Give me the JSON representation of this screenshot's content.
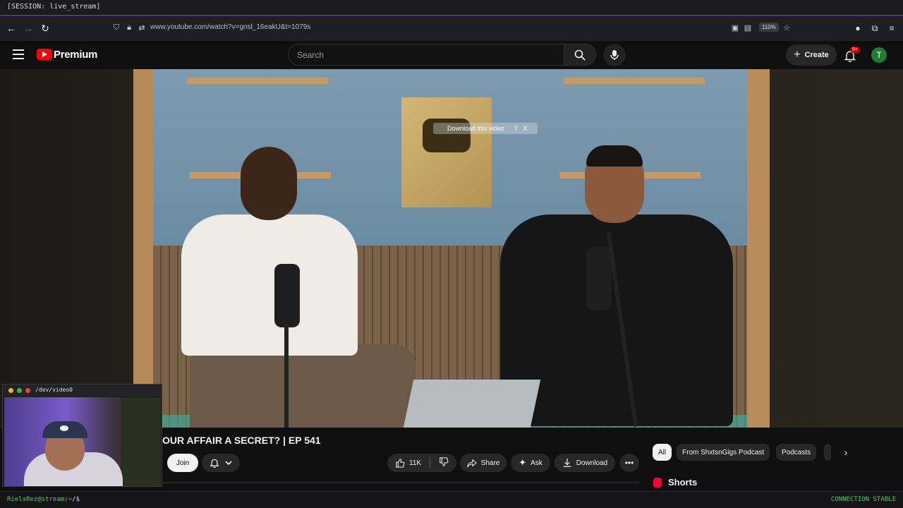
{
  "session": {
    "label": "[SESSION: live_stream]"
  },
  "browser": {
    "url": "www.youtube.com/watch?v=gnsl_16eakU&t=1079s",
    "zoom": "110%"
  },
  "youtube": {
    "brand": "Premium",
    "search_placeholder": "Search",
    "create_label": "Create",
    "notifications_badge": "9+",
    "avatar_letter": "T"
  },
  "video": {
    "overlay_text": "Download this video",
    "overlay_help": "?",
    "overlay_close": "X"
  },
  "webcam": {
    "title": "/dev/video0"
  },
  "info": {
    "title": "OUR AFFAIR A SECRET? | EP 541",
    "join_label": "Join",
    "likes": "11K",
    "share_label": "Share",
    "ask_label": "Ask",
    "download_label": "Download"
  },
  "chips": [
    "All",
    "From ShxtsnGigs Podcast",
    "Podcasts"
  ],
  "shorts_label": "Shorts",
  "terminal": {
    "prompt_user": "RielxRez@stream",
    "prompt_path": ":~/$",
    "status": "CONNECTION STABLE"
  },
  "colors": {
    "accent": "#6b3fa0",
    "youtube_red": "#ff0000",
    "status_green": "#42d35a",
    "avatar_green": "#1e7d32"
  }
}
